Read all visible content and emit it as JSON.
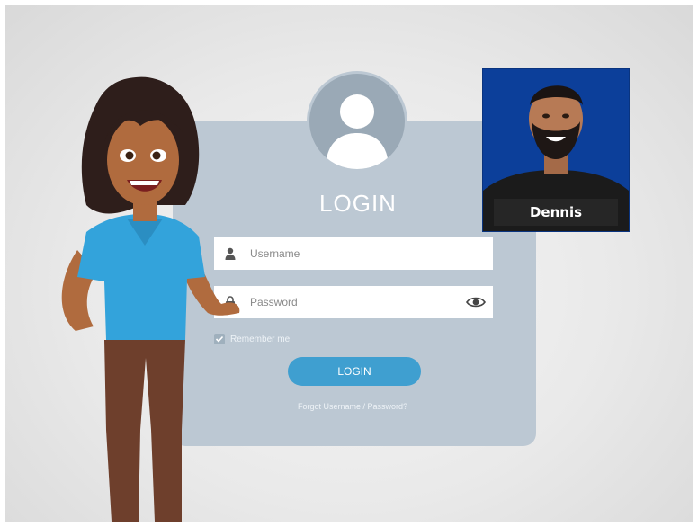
{
  "login": {
    "title": "LOGIN",
    "username_placeholder": "Username",
    "password_placeholder": "Password",
    "remember_label": "Remember me",
    "remember_checked": true,
    "button_label": "LOGIN",
    "forgot_link": "Forgot Username / Password?"
  },
  "webcam": {
    "name": "Dennis"
  },
  "icons": {
    "avatar": "user-silhouette-icon",
    "username": "person-icon",
    "password": "lock-icon",
    "reveal": "eye-icon",
    "checkbox": "check-icon"
  },
  "colors": {
    "card": "#bcc8d3",
    "button": "#3f9fd0",
    "webcam_bg": "#0c3f9a",
    "shirt": "#33a3db"
  }
}
